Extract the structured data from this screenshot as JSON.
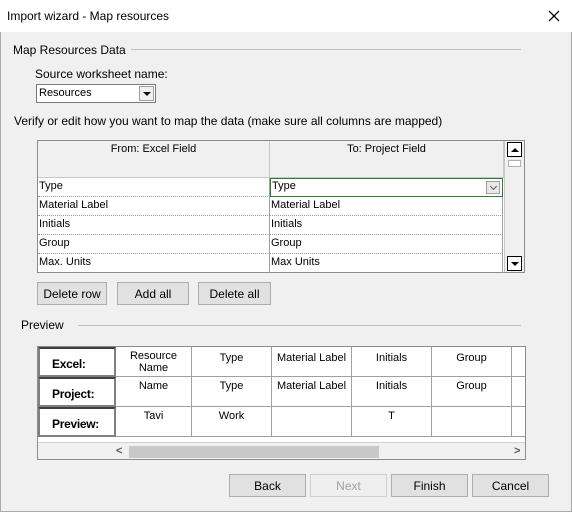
{
  "window": {
    "title": "Import wizard - Map resources",
    "close_glyph": "✕"
  },
  "map_section": {
    "group_label": "Map Resources Data",
    "source_label": "Source worksheet name:",
    "source_value": "Resources",
    "instructions": "Verify or edit how you want to map the data (make sure all columns are mapped)",
    "from_header": "From: Excel Field",
    "to_header": "To: Project Field",
    "rows": [
      {
        "from": "Type",
        "to": "Type"
      },
      {
        "from": "Material Label",
        "to": "Material Label"
      },
      {
        "from": "Initials",
        "to": "Initials"
      },
      {
        "from": "Group",
        "to": "Group"
      },
      {
        "from": "Max. Units",
        "to": "Max Units"
      }
    ],
    "buttons": {
      "delete_row": "Delete row",
      "add_all": "Add all",
      "delete_all": "Delete all"
    }
  },
  "preview_section": {
    "group_label": "Preview",
    "row_headers": [
      "Excel:",
      "Project:",
      "Preview:"
    ],
    "excel_row": [
      "Resource\nName",
      "Type",
      "Material Label",
      "Initials",
      "Group",
      ""
    ],
    "project_row": [
      "Name",
      "Type",
      "Material Label",
      "Initials",
      "Group",
      ""
    ],
    "preview_row": [
      "Tavi",
      "Work",
      "",
      "T",
      "",
      ""
    ],
    "scroll_left": "<",
    "scroll_right": ">"
  },
  "footer": {
    "back": "Back",
    "next": "Next",
    "finish": "Finish",
    "cancel": "Cancel"
  },
  "colors": {
    "active_cell_border": "#2e7d32",
    "window_bg": "#f0f0f0"
  }
}
